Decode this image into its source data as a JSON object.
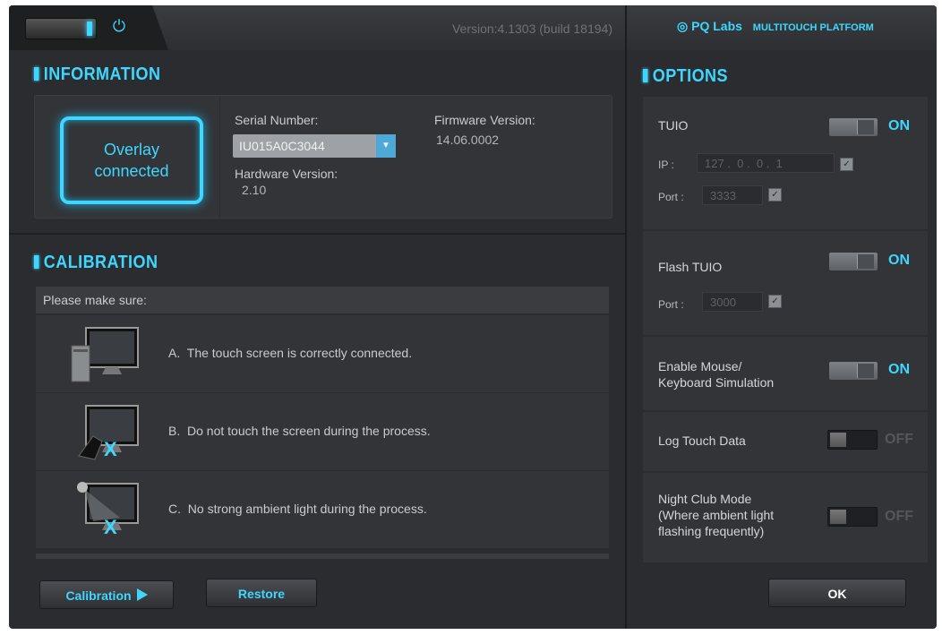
{
  "header": {
    "version": "Version:4.1303 (build 18194)",
    "brand_name": "PQ Labs",
    "brand_platform": "MULTITOUCH PLATFORM"
  },
  "information": {
    "title": "INFORMATION",
    "overlay_status": "Overlay connected",
    "serial_label": "Serial Number:",
    "serial_value": "IU015A0C3044",
    "hardware_label": "Hardware Version:",
    "hardware_value": "2.10",
    "firmware_label": "Firmware Version:",
    "firmware_value": "14.06.0002"
  },
  "calibration": {
    "title": "CALIBRATION",
    "heading": "Please make sure:",
    "items": [
      {
        "letter": "A.",
        "text": "The touch screen is correctly connected."
      },
      {
        "letter": "B.",
        "text": "Do not touch the screen during the process."
      },
      {
        "letter": "C.",
        "text": "No strong ambient light during the process."
      }
    ],
    "calibration_button": "Calibration",
    "restore_button": "Restore"
  },
  "options": {
    "title": "OPTIONS",
    "tuio_label": "TUIO",
    "tuio_state": "ON",
    "ip_label": "IP :",
    "ip_parts": [
      "127",
      "0",
      "0",
      "1"
    ],
    "tuio_port_label": "Port :",
    "tuio_port": "3333",
    "flash_label": "Flash TUIO",
    "flash_state": "ON",
    "flash_port_label": "Port :",
    "flash_port": "3000",
    "mouse_label_1": "Enable Mouse/",
    "mouse_label_2": "Keyboard Simulation",
    "mouse_state": "ON",
    "log_label": "Log Touch Data",
    "log_state": "OFF",
    "night_label_1": "Night Club Mode",
    "night_label_2": "(Where ambient light",
    "night_label_3": "flashing frequently)",
    "night_state": "OFF",
    "ok_button": "OK"
  }
}
